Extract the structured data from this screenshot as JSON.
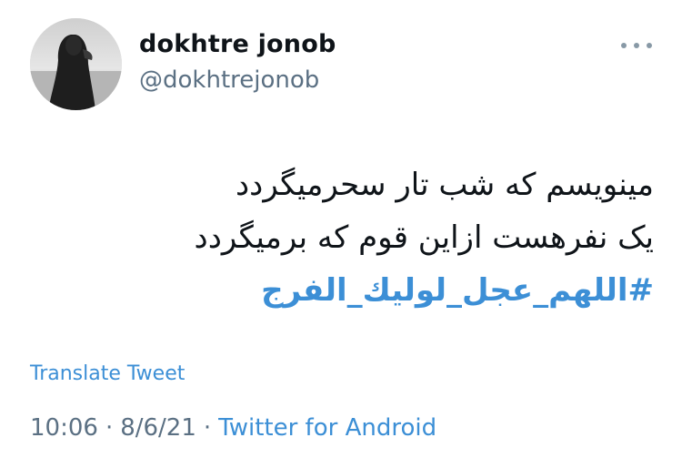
{
  "author": {
    "display_name": "dokhtre jonob",
    "handle": "@dokhtrejonob"
  },
  "tweet": {
    "lines": [
      "مینویسم که شب تار سحرمیگردد",
      "یک نفرهست ازاین قوم که برمیگردد"
    ],
    "hashtag": "#اللهم_عجل_لوليك_الفرج"
  },
  "translate_label": "Translate Tweet",
  "meta": {
    "time": "10:06",
    "date": "8/6/21",
    "separator": "·",
    "source": "Twitter for Android"
  },
  "icons": {
    "more": "more-horizontal-icon"
  },
  "colors": {
    "link": "#3c8fd6",
    "secondary_text": "#5b7083",
    "primary_text": "#0f1419"
  }
}
